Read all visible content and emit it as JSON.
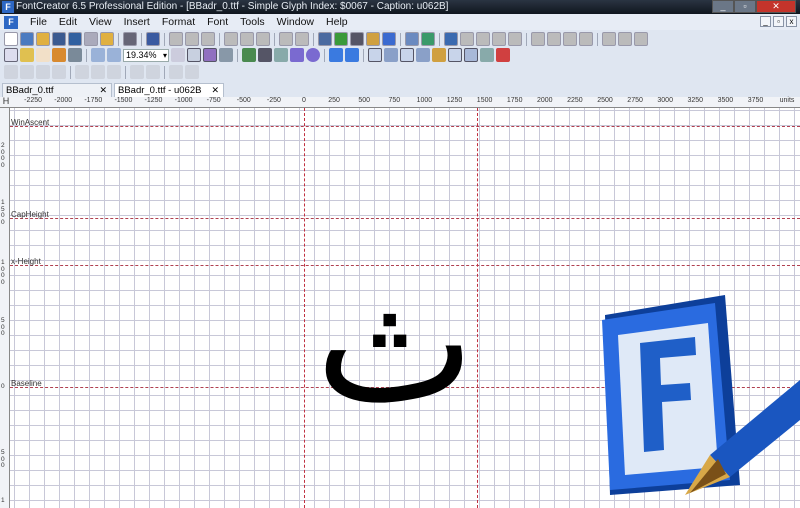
{
  "window": {
    "title": "FontCreator 6.5 Professional Edition - [BBadr_0.ttf - Simple Glyph Index: $0067 - Caption: u062B]",
    "app_icon": "F"
  },
  "menu": [
    "File",
    "Edit",
    "View",
    "Insert",
    "Format",
    "Font",
    "Tools",
    "Window",
    "Help"
  ],
  "toolbar": {
    "zoom_value": "19.34%"
  },
  "tabs": [
    {
      "label": "BBadr_0.ttf",
      "active": false
    },
    {
      "label": "BBadr_0.ttf - u062B",
      "active": true
    }
  ],
  "ruler": {
    "corner": "H",
    "units_label": "units",
    "x_labels": [
      "-2250",
      "-2000",
      "-1750",
      "-1500",
      "-1250",
      "-1000",
      "-750",
      "-500",
      "-250",
      "0",
      "250",
      "500",
      "750",
      "1000",
      "1250",
      "1500",
      "1750",
      "2000",
      "2250",
      "2500",
      "2750",
      "3000",
      "3250",
      "3500",
      "3750"
    ],
    "y_labels": [
      "2000",
      "1500",
      "1000",
      "500",
      "0",
      "500",
      "1"
    ]
  },
  "guides": {
    "win_ascent": "WinAscent",
    "cap_height": "CapHeight",
    "x_height": "x-Height",
    "baseline": "Baseline"
  },
  "glyph": {
    "char": "ث"
  },
  "colors": {
    "guide": "#b04050",
    "logo_blue": "#1f5fc8"
  }
}
